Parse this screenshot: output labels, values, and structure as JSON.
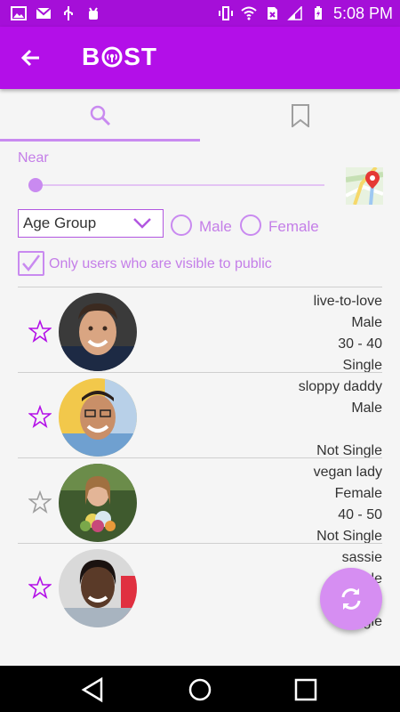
{
  "status_bar": {
    "time": "5:08 PM",
    "left_icons": [
      "image-icon",
      "mail-icon",
      "usb-icon",
      "android-debug-icon"
    ],
    "right_icons": [
      "vibrate-icon",
      "wifi-icon",
      "no-sim-icon",
      "signal-icon",
      "battery-charging-icon"
    ]
  },
  "app_bar": {
    "logo_left": "B",
    "logo_right": "ST",
    "back_icon": "arrow-left-icon"
  },
  "tabs": [
    {
      "name": "search",
      "icon": "search-icon",
      "active": true
    },
    {
      "name": "saved",
      "icon": "bookmark-icon",
      "active": false
    }
  ],
  "filters": {
    "near_label": "Near",
    "distance_fraction": 0.0,
    "map_icon": "map-icon",
    "age_group_value": "Age Group",
    "gender_options": [
      "Male",
      "Female"
    ],
    "visible_checkbox_label": "Only users who are visible to public",
    "visible_checked": true
  },
  "users": [
    {
      "username": "live-to-love",
      "gender": "Male",
      "age": "30 - 40",
      "status": "Single",
      "starred": true
    },
    {
      "username": "sloppy daddy",
      "gender": "Male",
      "age": "",
      "status": "Not Single",
      "starred": true
    },
    {
      "username": "vegan lady",
      "gender": "Female",
      "age": "40 - 50",
      "status": "Not Single",
      "starred": false
    },
    {
      "username": "sassie",
      "gender": "Female",
      "age": "",
      "status": "Single",
      "starred": true
    }
  ],
  "fab": {
    "icon": "refresh-icon"
  },
  "nav_bar": {
    "icons": [
      "back-triangle-icon",
      "home-circle-icon",
      "recents-square-icon"
    ]
  },
  "colors": {
    "primary": "#b30fe8",
    "status_bar": "#a50fd8",
    "accent": "#c98af0",
    "fab": "#d68ef2"
  }
}
